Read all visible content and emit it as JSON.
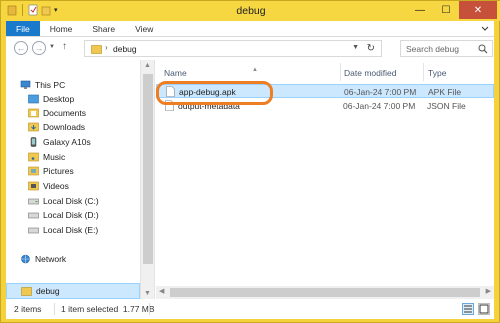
{
  "window": {
    "title": "debug"
  },
  "ribbon": {
    "tabs": [
      "File",
      "Home",
      "Share",
      "View"
    ]
  },
  "nav": {
    "breadcrumb": "debug",
    "search_placeholder": "Search debug"
  },
  "sidebar": {
    "items": [
      {
        "label": "This PC",
        "icon": "computer-icon"
      },
      {
        "label": "Desktop",
        "icon": "folder-icon"
      },
      {
        "label": "Documents",
        "icon": "folder-icon"
      },
      {
        "label": "Downloads",
        "icon": "folder-icon"
      },
      {
        "label": "Galaxy A10s",
        "icon": "phone-icon"
      },
      {
        "label": "Music",
        "icon": "folder-icon"
      },
      {
        "label": "Pictures",
        "icon": "folder-icon"
      },
      {
        "label": "Videos",
        "icon": "folder-icon"
      },
      {
        "label": "Local Disk (C:)",
        "icon": "drive-icon"
      },
      {
        "label": "Local Disk (D:)",
        "icon": "drive-icon"
      },
      {
        "label": "Local Disk (E:)",
        "icon": "drive-icon"
      },
      {
        "label": "Network",
        "icon": "network-icon"
      }
    ],
    "current_folder": "debug"
  },
  "files": {
    "columns": [
      "Name",
      "Date modified",
      "Type"
    ],
    "rows": [
      {
        "name": "app-debug.apk",
        "date": "06-Jan-24 7:00 PM",
        "type": "APK File",
        "selected": true
      },
      {
        "name": "output-metadata",
        "date": "06-Jan-24 7:00 PM",
        "type": "JSON File",
        "selected": false
      }
    ]
  },
  "status": {
    "count": "2 items",
    "selection": "1 item selected  1.77 MB"
  },
  "colors": {
    "titlebar": "#f6d641",
    "file_tab": "#1979ca",
    "selection": "#cce8ff",
    "highlight_ring": "#ef7d22"
  }
}
